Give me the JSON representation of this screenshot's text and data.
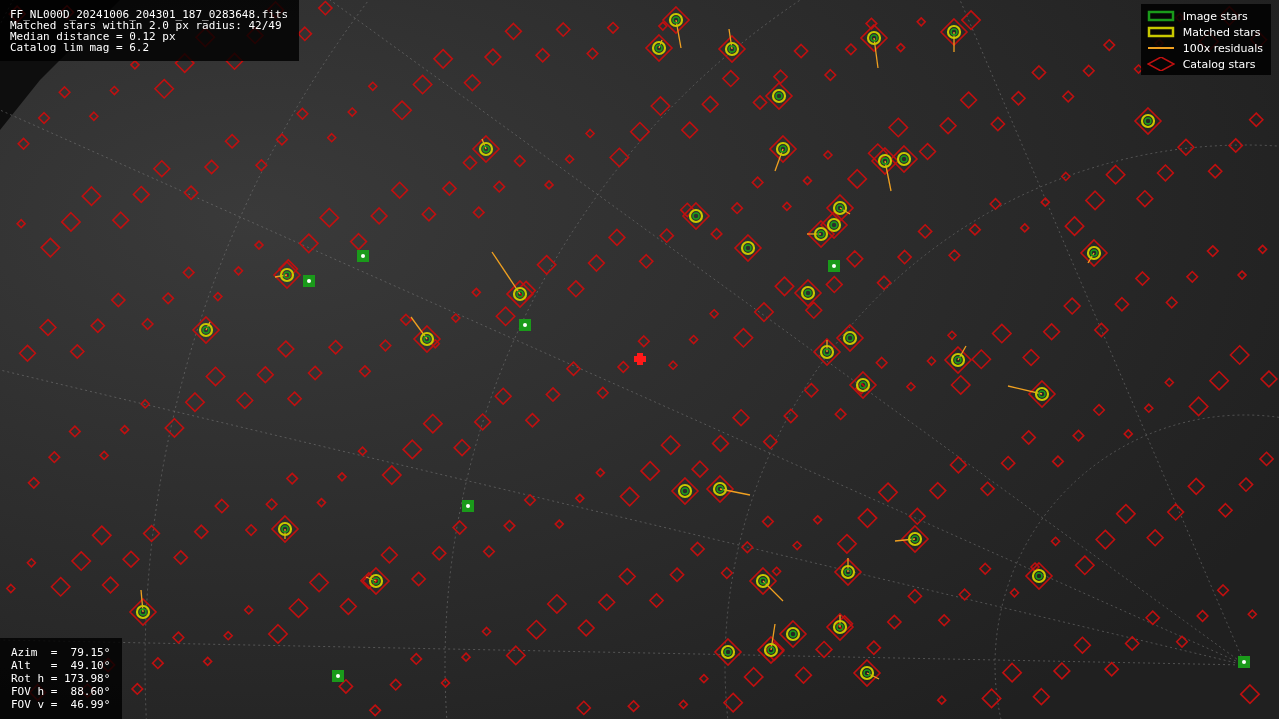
{
  "info_box": {
    "lines": [
      "FF_NL000D_20241006_204301_187_0283648.fits",
      "Matched stars within 2.0 px radius: 42/49",
      "Median distance = 0.12 px",
      "Catalog lim mag = 6.2"
    ]
  },
  "legend": {
    "items": [
      {
        "kind": "image",
        "label": "Image stars",
        "color": "#1a9a1a"
      },
      {
        "kind": "matched",
        "label": "Matched stars",
        "color": "#c8c800"
      },
      {
        "kind": "residual",
        "label": "100x residuals",
        "color": "#f0a020"
      },
      {
        "kind": "catalog",
        "label": "Catalog stars",
        "color": "#c01010"
      }
    ]
  },
  "pointing_box": {
    "lines": [
      "Azim  =  79.15°",
      "Alt   =  49.10°",
      "Rot h = 173.98°",
      "FOV h =  88.60°",
      "FOV v =  46.99°"
    ]
  }
}
